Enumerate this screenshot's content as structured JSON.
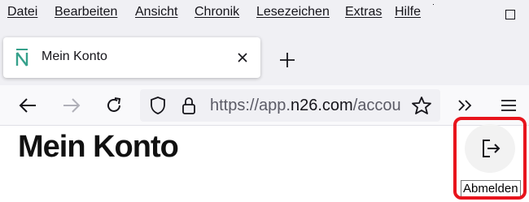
{
  "menubar": {
    "items": [
      {
        "label": "Datei",
        "underline": "D"
      },
      {
        "label": "Bearbeiten",
        "underline": "B"
      },
      {
        "label": "Ansicht",
        "underline": "A"
      },
      {
        "label": "Chronik",
        "underline": "C"
      },
      {
        "label": "Lesezeichen",
        "underline": "L"
      },
      {
        "label": "Extras",
        "underline": "E"
      },
      {
        "label": "Hilfe",
        "underline": "H"
      }
    ]
  },
  "tab": {
    "title": "Mein Konto",
    "favicon": "n26-logo",
    "favicon_color": "#36a18b"
  },
  "urlbar": {
    "prefix": "https://app.",
    "host": "n26.com",
    "suffix": "/accou"
  },
  "page": {
    "title": "Mein Konto"
  },
  "logout": {
    "icon": "logout-icon",
    "tooltip": "Abmelden"
  },
  "colors": {
    "highlight": "#e8141c",
    "chrome": "#f0f0f4"
  }
}
